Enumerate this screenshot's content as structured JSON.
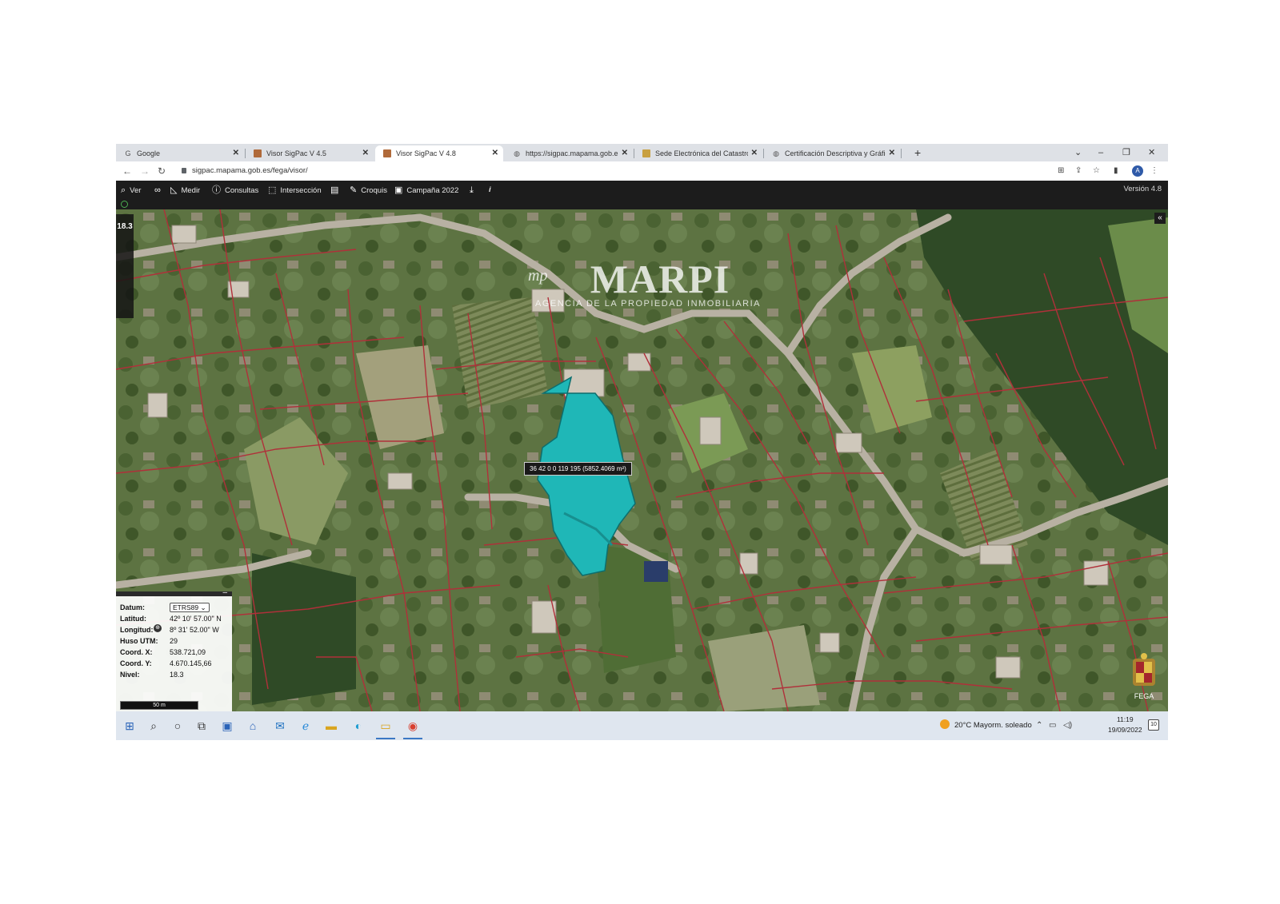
{
  "browser": {
    "tabs": [
      {
        "label": "Google",
        "favicon": "G"
      },
      {
        "label": "Visor SigPac V 4.5",
        "favicon": ""
      },
      {
        "label": "Visor SigPac V 4.8",
        "favicon": ""
      },
      {
        "label": "https://sigpac.mapama.gob.es/fe",
        "favicon": ""
      },
      {
        "label": "Sede Electrónica del Catastro - C",
        "favicon": ""
      },
      {
        "label": "Certificación Descriptiva y Gráfic",
        "favicon": ""
      }
    ],
    "new_tab": "+",
    "url": "sigpac.mapama.gob.es/fega/visor/"
  },
  "toolbar": {
    "ver": "Ver",
    "medir": "Medir",
    "consultas": "Consultas",
    "interseccion": "Intersección",
    "croquis": "Croquis",
    "campana": "Campaña 2022",
    "info": "i",
    "version": "Versión 4.8"
  },
  "map": {
    "zoom_level": "18.3",
    "watermark": {
      "mark": "mp",
      "name": "MARPI",
      "subtitle": "AGENCIA DE LA PROPIEDAD INMOBILIARIA"
    },
    "parcel_label": "36 42 0 0 119 195 (5852.4069 m²)",
    "parcel_color": "#1fb7b7",
    "boundary_color": "#b0303a",
    "emblem_text": "FEGA"
  },
  "coords": {
    "datum_label": "Datum:",
    "datum_value": "ETRS89",
    "latitud_label": "Latitud:",
    "latitud_value": "42º 10' 57.00\" N",
    "longitud_label": "Longitud:",
    "longitud_value": "8º 31' 52.00\" W",
    "huso_label": "Huso UTM:",
    "huso_value": "29",
    "coordx_label": "Coord. X:",
    "coordx_value": "538.721,09",
    "coordy_label": "Coord. Y:",
    "coordy_value": "4.670.145,66",
    "nivel_label": "Nivel:",
    "nivel_value": "18.3",
    "scale": "50 m"
  },
  "taskbar": {
    "weather": "20°C  Mayorm. soleado",
    "time": "11:19",
    "date": "19/09/2022",
    "notifications": "10"
  }
}
